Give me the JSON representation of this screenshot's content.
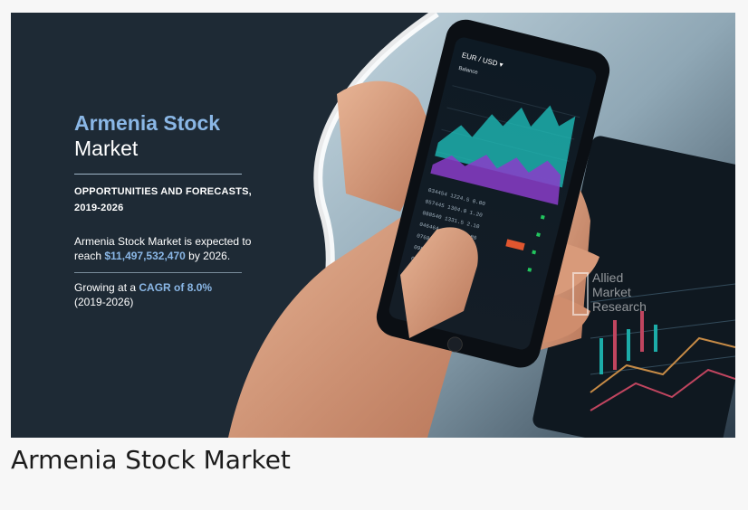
{
  "banner": {
    "title_line1": "Armenia Stock",
    "title_line2": "Market",
    "subtitle_line1": "OPPORTUNITIES AND FORECASTS,",
    "subtitle_line2": "2019-2026",
    "expected_prefix": "Armenia Stock Market is expected to reach",
    "expected_value": "$11,497,532,470",
    "expected_suffix": "by 2026.",
    "growth_prefix": "Growing at a",
    "growth_cagr": "CAGR of 8.0%",
    "growth_period": "(2019-2026)",
    "phone_pair": "EUR / USD",
    "phone_balance_label": "Balance",
    "watermark_line1": "Allied",
    "watermark_line2": "Market",
    "watermark_line3": "Research",
    "colors": {
      "background": "#1e2a35",
      "accent": "#8ab7e6",
      "chart_teal": "#1fc6c0",
      "chart_purple": "#8a3cc9"
    }
  },
  "caption": "Armenia Stock Market"
}
